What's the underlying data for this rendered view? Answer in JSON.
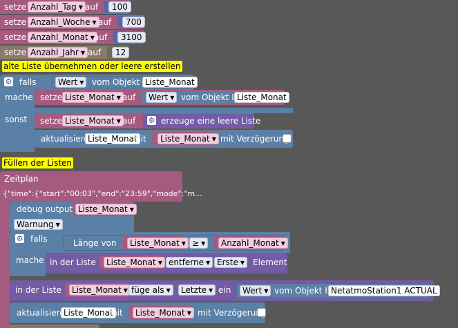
{
  "sets": [
    {
      "label": "setze",
      "var": "Anzahl_Tag",
      "op": "auf",
      "val": "100"
    },
    {
      "label": "setze",
      "var": "Anzahl_Woche",
      "op": "auf",
      "val": "700"
    },
    {
      "label": "setze",
      "var": "Anzahl_Monat",
      "op": "auf",
      "val": "3100"
    },
    {
      "label": "setze",
      "var": "Anzahl_Jahr",
      "op": "auf",
      "val": "12"
    }
  ],
  "comment1": "alte Liste übernehmen oder leere erstellen",
  "if1": {
    "falls": "falls",
    "wert": "Wert",
    "vom": "vom Objekt ID",
    "obj": "Liste_Monat",
    "mache": "mache",
    "setze": "setze",
    "var": "Liste_Monat",
    "auf": "auf",
    "wert2": "Wert",
    "vom2": "vom Objekt ID",
    "obj2": "Liste_Monat",
    "sonst": "sonst",
    "setze2": "setze",
    "var2": "Liste_Monat",
    "auf2": "auf",
    "create": "erzeuge eine leere Liste",
    "upd": "aktualisiere",
    "updobj": "Liste_Monat",
    "mit": "mit",
    "updvar": "Liste_Monat",
    "delay": "mit Verzögerung"
  },
  "comment2": "Füllen der Listen",
  "sched": {
    "label": "Zeitplan",
    "value": "{\"time\":{\"start\":\"00:03\",\"end\":\"23:59\",\"mode\":\"m..."
  },
  "debug": {
    "label": "debug output",
    "var": "Liste_Monat",
    "level": "Warnung"
  },
  "if2": {
    "falls": "falls",
    "len": "Länge von",
    "var": "Liste_Monat",
    "cmp": "≥",
    "var2": "Anzahl_Monat",
    "mache": "mache",
    "inlist": "in der Liste",
    "lvar": "Liste_Monat",
    "remove": "entferne",
    "first": "Erste",
    "elem": "Element"
  },
  "insert": {
    "inlist": "in der Liste",
    "var": "Liste_Monat",
    "add": "füge als",
    "last": "Letzte",
    "ein": "ein",
    "wert": "Wert",
    "vom": "vom Objekt ID",
    "obj": "NetatmoStation1 ACTUAL"
  },
  "upd2": {
    "upd": "aktualisiere",
    "obj": "Liste_Monat",
    "mit": "mit",
    "var": "Liste_Monat",
    "delay": "mit Verzögerung"
  },
  "colors": {
    "variable": "#a55b80",
    "logic": "#5b80a5",
    "list": "#745ba5",
    "comment": "#ffff00",
    "number": "#5b67a5"
  }
}
